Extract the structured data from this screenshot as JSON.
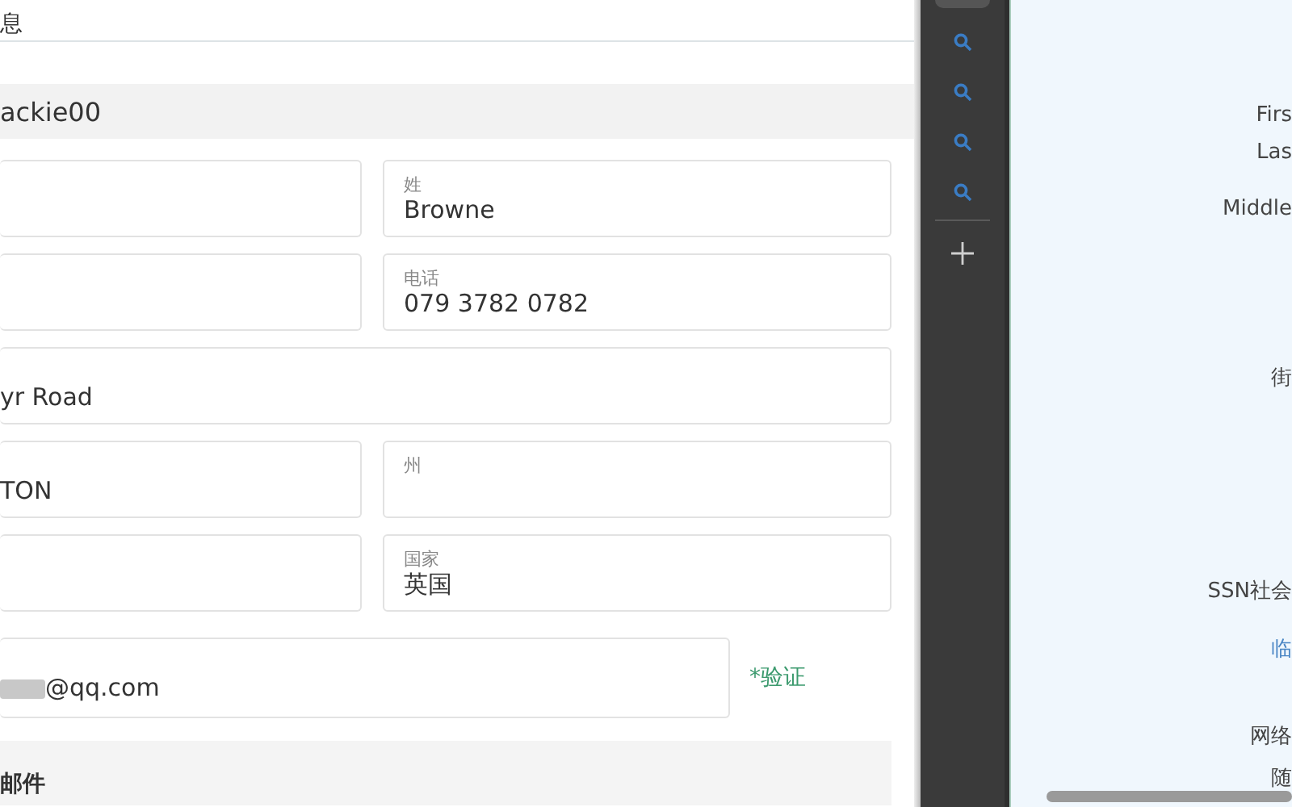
{
  "header": {
    "title": "息"
  },
  "account_bar": {
    "username": "ackie00"
  },
  "form_rows": [
    {
      "kind": "pair",
      "fields": [
        {
          "kind": "blank"
        },
        {
          "kind": "labeled",
          "label": "姓",
          "value": "Browne"
        }
      ]
    },
    {
      "kind": "pair",
      "fields": [
        {
          "kind": "blank"
        },
        {
          "kind": "labeled",
          "label": "电话",
          "value": "079 3782 0782"
        }
      ]
    },
    {
      "kind": "full",
      "fields": [
        {
          "kind": "value",
          "value": "yr Road"
        }
      ]
    },
    {
      "kind": "pair",
      "fields": [
        {
          "kind": "value",
          "value": "TON"
        },
        {
          "kind": "labeled",
          "label": "州"
        }
      ]
    },
    {
      "kind": "pair",
      "fields": [
        {
          "kind": "blank"
        },
        {
          "kind": "labeled",
          "label": "国家",
          "value": "英国"
        }
      ]
    }
  ],
  "email": {
    "value": "@qq.com",
    "verify_link": "*验证"
  },
  "mail_section": {
    "title": "邮件"
  },
  "side_toolbar": {
    "tools": [
      {
        "kind": "search"
      },
      {
        "kind": "search"
      },
      {
        "kind": "search"
      },
      {
        "kind": "search"
      },
      {
        "kind": "add"
      }
    ]
  },
  "right_panel": {
    "labels": [
      {
        "text": "Firs",
        "kind": "plain"
      },
      {
        "text": "Las",
        "kind": "plain"
      },
      {
        "text": "Middle",
        "kind": "plain"
      },
      {
        "text": "街",
        "kind": "plain"
      },
      {
        "text": "SSN社会",
        "kind": "plain"
      },
      {
        "text": "临",
        "kind": "link"
      },
      {
        "text": "网络",
        "kind": "plain"
      },
      {
        "text": "随",
        "kind": "plain"
      }
    ]
  }
}
